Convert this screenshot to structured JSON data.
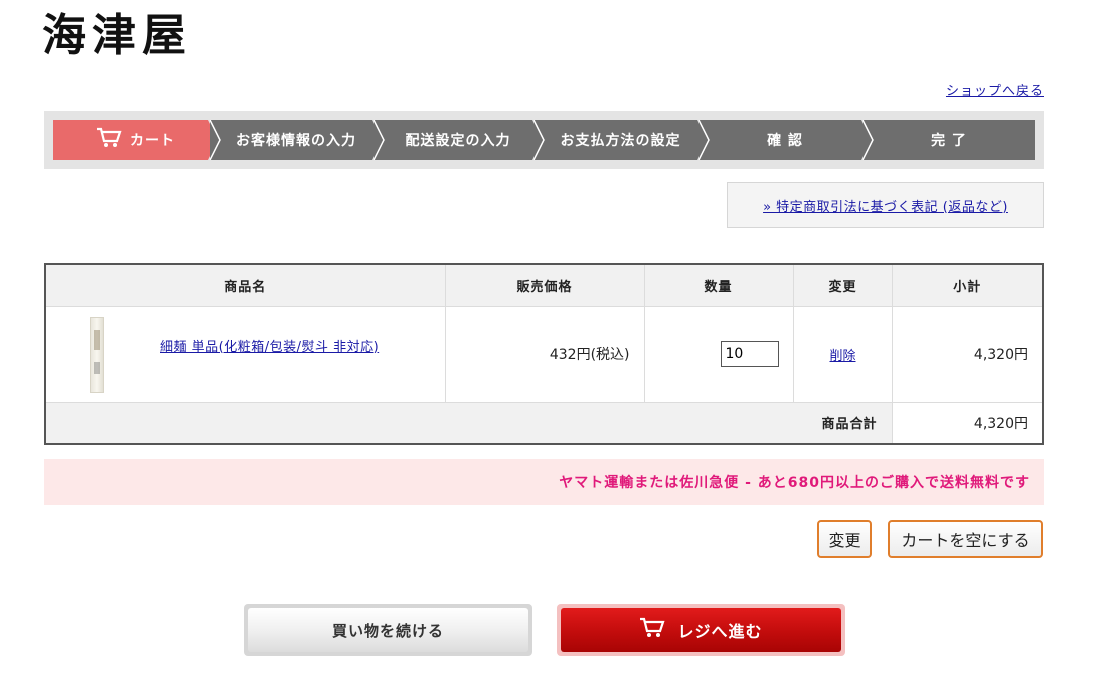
{
  "header": {
    "logo_text": "海津屋",
    "back_link": "ショップへ戻る"
  },
  "steps": [
    {
      "label": "カート",
      "active": true,
      "icon": "cart-icon"
    },
    {
      "label": "お客様情報の入力",
      "active": false
    },
    {
      "label": "配送設定の入力",
      "active": false
    },
    {
      "label": "お支払方法の設定",
      "active": false
    },
    {
      "label": "確 認",
      "active": false
    },
    {
      "label": "完 了",
      "active": false
    }
  ],
  "tokutei_link": "» 特定商取引法に基づく表記 (返品など)",
  "cart": {
    "headers": {
      "name": "商品名",
      "price": "販売価格",
      "qty": "数量",
      "change": "変更",
      "subtotal": "小計"
    },
    "items": [
      {
        "name": "細麺 単品(化粧箱/包装/熨斗 非対応)",
        "price": "432円(税込)",
        "qty": "10",
        "delete": "削除",
        "subtotal": "4,320円"
      }
    ],
    "total_label": "商品合計",
    "total_value": "4,320円"
  },
  "notice": "ヤマト運輸または佐川急便 - あと680円以上のご購入で送料無料です",
  "buttons": {
    "change": "変更",
    "empty_cart": "カートを空にする",
    "continue_shopping": "買い物を続ける",
    "checkout": "レジへ進む"
  },
  "colors": {
    "active_step": "#e96a6a",
    "inactive_step": "#6e6e6e",
    "notice_bg": "#fde8e8",
    "notice_text": "#e0197a",
    "checkout_red": "#c20c0c",
    "button_border": "#e07e2c"
  }
}
